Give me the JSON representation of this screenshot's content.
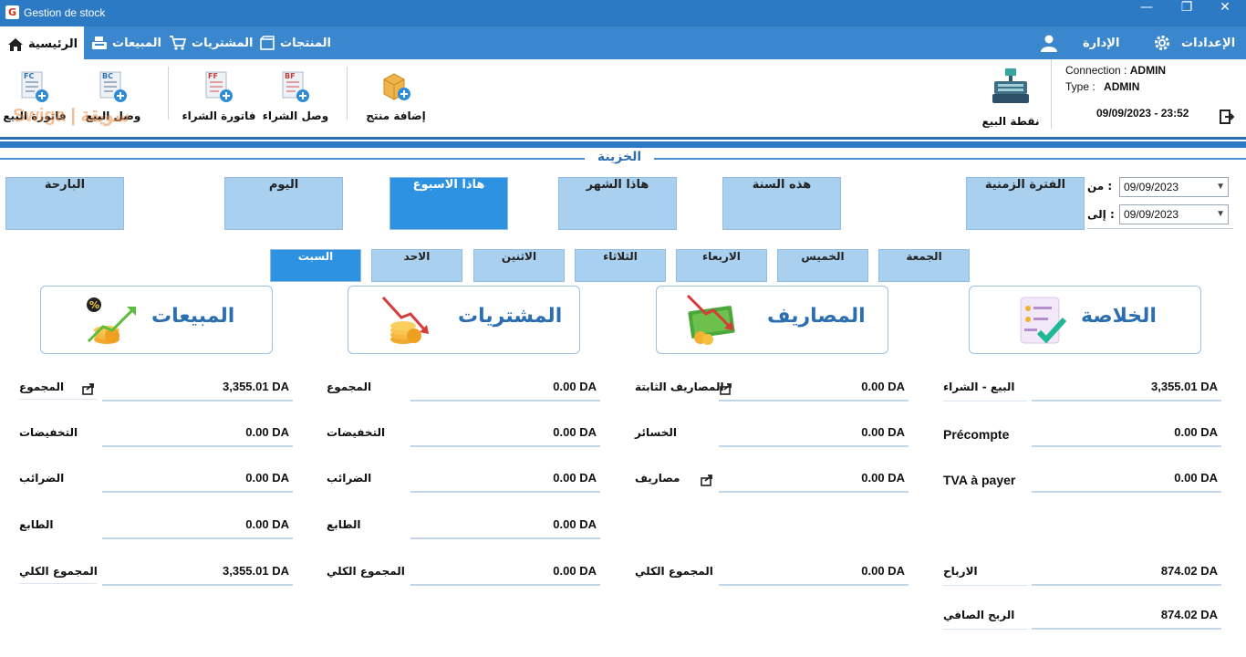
{
  "window": {
    "title": "Gestion de stock",
    "app_icon": "G",
    "minimize": "—",
    "maximize": "❐",
    "close": "✕"
  },
  "menu": {
    "home": "الرئيسية",
    "sales": "المبيعات",
    "purchases": "المشتريات",
    "products": "المنتجات",
    "admin": "الإدارة",
    "settings": "الإعدادات"
  },
  "toolbar": {
    "sale_invoice": "فاتورة البيع",
    "sale_invoice_badge": "FC",
    "sale_voucher": "وصل البيع",
    "sale_voucher_badge": "BC",
    "purchase_invoice": "فاتورة الشراء",
    "purchase_invoice_badge": "FF",
    "purchase_voucher": "وصل الشراء",
    "purchase_voucher_badge": "BF",
    "add_product": "إضافة منتج",
    "pos": "نقطة البيع"
  },
  "watermark": "Swiga | سويقة",
  "session": {
    "connection_label": "Connection :",
    "connection_user": "ADMIN",
    "type_label": "Type :",
    "type_value": "ADMIN",
    "datetime": "09/09/2023 - 23:52"
  },
  "section_title": "الخزينة",
  "periods": {
    "yesterday": "البارحة",
    "today": "اليوم",
    "this_week": "هاذا الاسبوع",
    "this_month": "هاذا الشهر",
    "this_year": "هذه السنة",
    "range": "الفترة الزمنية",
    "active": "this_week"
  },
  "date_from": {
    "label": "من :",
    "value": "09/09/2023"
  },
  "date_to": {
    "label": "إلى :",
    "value": "09/09/2023"
  },
  "days": [
    "السبت",
    "الاحد",
    "الاثنين",
    "الثلاثاء",
    "الاربعاء",
    "الخميس",
    "الجمعة"
  ],
  "active_day": "السبت",
  "cards": {
    "sales": "المبيعات",
    "purchases": "المشتريات",
    "expenses": "المصاريف",
    "summary": "الخلاصة"
  },
  "sales": {
    "total": "3,355.01 DA",
    "discounts": "0.00 DA",
    "taxes": "0.00 DA",
    "stamp": "0.00 DA",
    "grand_total": "3,355.01 DA"
  },
  "purchases": {
    "total": "0.00 DA",
    "discounts": "0.00 DA",
    "taxes": "0.00 DA",
    "stamp": "0.00 DA",
    "grand_total": "0.00 DA"
  },
  "expenses": {
    "fixed": "0.00 DA",
    "losses": "0.00 DA",
    "expenses": "0.00 DA",
    "grand_total": "0.00 DA"
  },
  "summary": {
    "sale_minus_purchase": "3,355.01 DA",
    "precompte": "0.00 DA",
    "tva": "0.00 DA",
    "profits": "874.02 DA",
    "net_profit": "874.02 DA"
  },
  "labels": {
    "total": "المجموع",
    "discounts": "التخفيضات",
    "taxes": "الضرائب",
    "stamp": "الطابع",
    "grand_total": "المجموع الكلي",
    "fixed_expenses": "المصاريف الثابتة",
    "losses": "الخسائر",
    "expenses": "مصاريف",
    "sale_minus_purchase": "البيع - الشراء",
    "precompte": "Précompte",
    "tva": "TVA à payer",
    "profits": "الارباح",
    "net_profit": "الربح الصافي"
  },
  "colors": {
    "titlebar": "#2d7ac4",
    "menubar": "#3b87cd",
    "button": "#a9d0ef",
    "active": "#2e92e2",
    "card_title": "#2b6fb2"
  }
}
